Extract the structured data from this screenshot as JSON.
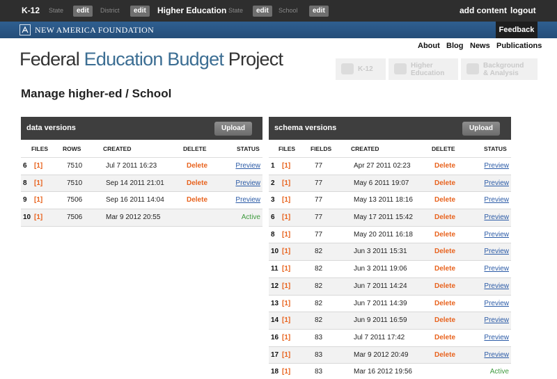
{
  "admin_bar": {
    "k12_label": "K-12",
    "k12_state": "State",
    "edit1": "edit",
    "k12_district": "District",
    "edit2": "edit",
    "he_label": "Higher Education",
    "he_state": "State",
    "edit3": "edit",
    "he_school": "School",
    "edit4": "edit",
    "add_content": "add content",
    "logout": "logout"
  },
  "foundation": {
    "name": "NEW AMERICA FOUNDATION",
    "feedback": "Feedback"
  },
  "header": {
    "title_part1": "Federal ",
    "title_part2": "Education Budget",
    "title_part3": " Project",
    "nav": [
      "About",
      "Blog",
      "News",
      "Publications"
    ],
    "section_tabs": [
      {
        "line1": "K-12",
        "line2": ""
      },
      {
        "line1": "Higher",
        "line2": "Education"
      },
      {
        "line1": "Background",
        "line2": "& Analysis"
      }
    ]
  },
  "page_title": "Manage higher-ed / School",
  "data_versions": {
    "title": "data versions",
    "upload": "Upload",
    "columns": [
      "FILES",
      "ROWS",
      "CREATED",
      "DELETE",
      "STATUS"
    ],
    "rows": [
      {
        "id": "6",
        "link": "[1]",
        "count": "7510",
        "created": "Jul 7 2011 16:23",
        "delete": "Delete",
        "status": "Preview",
        "active": false
      },
      {
        "id": "8",
        "link": "[1]",
        "count": "7510",
        "created": "Sep 14 2011 21:01",
        "delete": "Delete",
        "status": "Preview",
        "active": false
      },
      {
        "id": "9",
        "link": "[1]",
        "count": "7506",
        "created": "Sep 16 2011 14:04",
        "delete": "Delete",
        "status": "Preview",
        "active": false
      },
      {
        "id": "10",
        "link": "[1]",
        "count": "7506",
        "created": "Mar 9 2012 20:55",
        "delete": "",
        "status": "Active",
        "active": true
      }
    ]
  },
  "schema_versions": {
    "title": "schema versions",
    "upload": "Upload",
    "columns": [
      "FILES",
      "FIELDS",
      "CREATED",
      "DELETE",
      "STATUS"
    ],
    "rows": [
      {
        "id": "1",
        "link": "[1]",
        "count": "77",
        "created": "Apr 27 2011 02:23",
        "delete": "Delete",
        "status": "Preview",
        "active": false
      },
      {
        "id": "2",
        "link": "[1]",
        "count": "77",
        "created": "May 6 2011 19:07",
        "delete": "Delete",
        "status": "Preview",
        "active": false
      },
      {
        "id": "3",
        "link": "[1]",
        "count": "77",
        "created": "May 13 2011 18:16",
        "delete": "Delete",
        "status": "Preview",
        "active": false
      },
      {
        "id": "6",
        "link": "[1]",
        "count": "77",
        "created": "May 17 2011 15:42",
        "delete": "Delete",
        "status": "Preview",
        "active": false
      },
      {
        "id": "8",
        "link": "[1]",
        "count": "77",
        "created": "May 20 2011 16:18",
        "delete": "Delete",
        "status": "Preview",
        "active": false
      },
      {
        "id": "10",
        "link": "[1]",
        "count": "82",
        "created": "Jun 3 2011 15:31",
        "delete": "Delete",
        "status": "Preview",
        "active": false
      },
      {
        "id": "11",
        "link": "[1]",
        "count": "82",
        "created": "Jun 3 2011 19:06",
        "delete": "Delete",
        "status": "Preview",
        "active": false
      },
      {
        "id": "12",
        "link": "[1]",
        "count": "82",
        "created": "Jun 7 2011 14:24",
        "delete": "Delete",
        "status": "Preview",
        "active": false
      },
      {
        "id": "13",
        "link": "[1]",
        "count": "82",
        "created": "Jun 7 2011 14:39",
        "delete": "Delete",
        "status": "Preview",
        "active": false
      },
      {
        "id": "14",
        "link": "[1]",
        "count": "82",
        "created": "Jun 9 2011 16:59",
        "delete": "Delete",
        "status": "Preview",
        "active": false
      },
      {
        "id": "16",
        "link": "[1]",
        "count": "83",
        "created": "Jul 7 2011 17:42",
        "delete": "Delete",
        "status": "Preview",
        "active": false
      },
      {
        "id": "17",
        "link": "[1]",
        "count": "83",
        "created": "Mar 9 2012 20:49",
        "delete": "Delete",
        "status": "Preview",
        "active": false
      },
      {
        "id": "18",
        "link": "[1]",
        "count": "83",
        "created": "Mar 16 2012 19:56",
        "delete": "",
        "status": "Active",
        "active": true
      }
    ]
  },
  "colors": {
    "topbar": "#2e2e2e",
    "foundation_blue": "#2f5f90",
    "delete_orange": "#e8631e",
    "link_blue": "#2a5aa6",
    "active_green": "#3e9a3e",
    "panel_header": "#3e3e3e"
  },
  "icons": [
    "apple-icon",
    "graduation-cap-icon",
    "books-icon",
    "foundation-logo-icon"
  ]
}
